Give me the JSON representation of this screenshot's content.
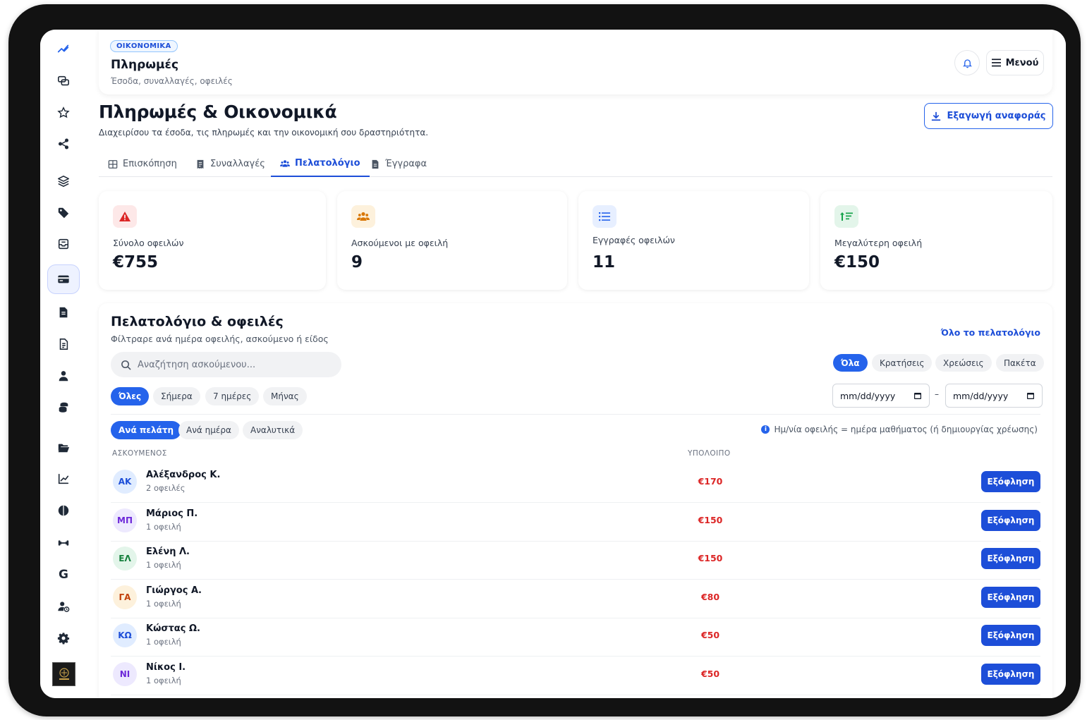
{
  "header": {
    "tag": "ΟΙΚΟΝΟΜΙΚΑ",
    "title": "Πληρωμές",
    "subtitle": "Έσοδα, συναλλαγές, οφειλές",
    "menu_label": "Μενού"
  },
  "page": {
    "title": "Πληρωμές & Οικονομικά",
    "subtitle": "Διαχειρίσου τα έσοδα, τις πληρωμές και την οικονομική σου δραστηριότητα.",
    "export_label": "Εξαγωγή αναφοράς"
  },
  "tabs": [
    {
      "label": "Επισκόπηση",
      "icon": "grid-icon"
    },
    {
      "label": "Συναλλαγές",
      "icon": "receipt-icon"
    },
    {
      "label": "Πελατολόγιο",
      "icon": "users-icon",
      "active": true
    },
    {
      "label": "Έγγραφα",
      "icon": "document-icon"
    }
  ],
  "stats": [
    {
      "label": "Σύνολο οφειλών",
      "value": "€755",
      "icon": "warning-icon",
      "color": "#dc2626"
    },
    {
      "label": "Ασκούμενοι με οφειλή",
      "value": "9",
      "icon": "users-icon",
      "color": "#d97706"
    },
    {
      "label": "Εγγραφές οφειλών",
      "value": "11",
      "icon": "list-icon",
      "color": "#2563eb"
    },
    {
      "label": "Μεγαλύτερη οφειλή",
      "value": "€150",
      "icon": "sort-desc-icon",
      "color": "#16a34a"
    }
  ],
  "panel": {
    "title": "Πελατολόγιο & οφειλές",
    "subtitle": "Φίλτραρε ανά ημέρα οφειλής, ασκούμενο ή είδος",
    "link": "Όλο το πελατολόγιο",
    "search_placeholder": "Αναζήτηση ασκούμενου...",
    "type_filters": [
      "Όλα",
      "Κρατήσεις",
      "Χρεώσεις",
      "Πακέτα"
    ],
    "period_filters": [
      "Όλες",
      "Σήμερα",
      "7 ημέρες",
      "Μήνας"
    ],
    "date_from": "mm/dd/yyyy",
    "date_to": "mm/dd/yyyy",
    "date_sep": "–",
    "view_filters": [
      "Ανά πελάτη",
      "Ανά ημέρα",
      "Αναλυτικά"
    ],
    "info": "Ημ/νία οφειλής = ημέρα μαθήματος (ή δημιουργίας χρέωσης)",
    "columns": [
      "ΑΣΚΟΥΜΕΝΟΣ",
      "ΥΠΟΛΟΙΠΟ"
    ],
    "action_label": "Εξόφληση",
    "rows": [
      {
        "initials": "ΑΚ",
        "name": "Αλέξανδρος Κ.",
        "sub": "2 οφειλές",
        "balance": "€170",
        "bg": "#e0ecff",
        "fg": "#1d4ed8"
      },
      {
        "initials": "ΜΠ",
        "name": "Μάριος Π.",
        "sub": "1 οφειλή",
        "balance": "€150",
        "bg": "#ede9fe",
        "fg": "#6d28d9"
      },
      {
        "initials": "ΕΛ",
        "name": "Ελένη Λ.",
        "sub": "1 οφειλή",
        "balance": "€150",
        "bg": "#e3f5ea",
        "fg": "#15803d"
      },
      {
        "initials": "ΓΑ",
        "name": "Γιώργος Α.",
        "sub": "1 οφειλή",
        "balance": "€80",
        "bg": "#fdf1dc",
        "fg": "#c2410c"
      },
      {
        "initials": "ΚΩ",
        "name": "Κώστας Ω.",
        "sub": "1 οφειλή",
        "balance": "€50",
        "bg": "#e0ecff",
        "fg": "#1d4ed8"
      },
      {
        "initials": "ΝΙ",
        "name": "Νίκος Ι.",
        "sub": "1 οφειλή",
        "balance": "€50",
        "bg": "#ede9fe",
        "fg": "#6d28d9"
      }
    ]
  },
  "sidebar": {
    "items": [
      {
        "icon": "trend-icon"
      },
      {
        "icon": "chat-icon"
      },
      {
        "icon": "star-icon"
      },
      {
        "icon": "share-icon"
      },
      {
        "icon": "layers-icon"
      },
      {
        "icon": "tag-icon"
      },
      {
        "icon": "inbox-icon"
      },
      {
        "icon": "card-icon",
        "active": true
      },
      {
        "icon": "invoice-icon"
      },
      {
        "icon": "report-icon"
      },
      {
        "icon": "user-icon"
      },
      {
        "icon": "coins-icon"
      },
      {
        "icon": "folder-icon"
      },
      {
        "icon": "chart-icon"
      },
      {
        "icon": "half-circle-icon"
      },
      {
        "icon": "dumbbell-icon"
      },
      {
        "icon": "google-icon"
      },
      {
        "icon": "user-clock-icon"
      },
      {
        "icon": "gear-icon"
      }
    ]
  }
}
